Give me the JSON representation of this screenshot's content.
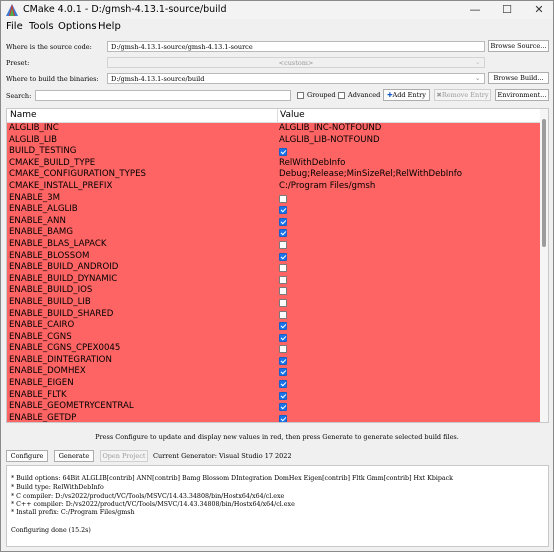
{
  "window": {
    "title": "CMake 4.0.1 - D:/gmsh-4.13.1-source/build",
    "controls": [
      "—",
      "☐",
      "✕"
    ]
  },
  "menu": [
    "File",
    "Tools",
    "Options",
    "Help"
  ],
  "source": {
    "label": "Where is the source code:",
    "value": "D:/gmsh-4.13.1-source/gmsh-4.13.1-source",
    "browse": "Browse Source..."
  },
  "preset": {
    "label": "Preset:",
    "value": "<custom>"
  },
  "build": {
    "label": "Where to build the binaries:",
    "value": "D:/gmsh-4.13.1-source/build",
    "browse": "Browse Build..."
  },
  "search": {
    "label": "Search:",
    "value": "",
    "grouped": "Grouped",
    "advanced": "Advanced",
    "add_entry": "Add Entry",
    "remove_entry": "Remove Entry",
    "environment": "Environment..."
  },
  "table": {
    "headers": [
      "Name",
      "Value"
    ],
    "rows": [
      {
        "name": "ALGLIB_INC",
        "value": "ALGLIB_INC-NOTFOUND"
      },
      {
        "name": "ALGLIB_LIB",
        "value": "ALGLIB_LIB-NOTFOUND"
      },
      {
        "name": "BUILD_TESTING",
        "check": true
      },
      {
        "name": "CMAKE_BUILD_TYPE",
        "value": "RelWithDebInfo"
      },
      {
        "name": "CMAKE_CONFIGURATION_TYPES",
        "value": "Debug;Release;MinSizeRel;RelWithDebInfo"
      },
      {
        "name": "CMAKE_INSTALL_PREFIX",
        "value": "C:/Program Files/gmsh"
      },
      {
        "name": "ENABLE_3M",
        "check": false
      },
      {
        "name": "ENABLE_ALGLIB",
        "check": true
      },
      {
        "name": "ENABLE_ANN",
        "check": true
      },
      {
        "name": "ENABLE_BAMG",
        "check": true
      },
      {
        "name": "ENABLE_BLAS_LAPACK",
        "check": false
      },
      {
        "name": "ENABLE_BLOSSOM",
        "check": true
      },
      {
        "name": "ENABLE_BUILD_ANDROID",
        "check": false
      },
      {
        "name": "ENABLE_BUILD_DYNAMIC",
        "check": false
      },
      {
        "name": "ENABLE_BUILD_IOS",
        "check": false
      },
      {
        "name": "ENABLE_BUILD_LIB",
        "check": false
      },
      {
        "name": "ENABLE_BUILD_SHARED",
        "check": false
      },
      {
        "name": "ENABLE_CAIRO",
        "check": true
      },
      {
        "name": "ENABLE_CGNS",
        "check": true
      },
      {
        "name": "ENABLE_CGNS_CPEX0045",
        "check": false
      },
      {
        "name": "ENABLE_DINTEGRATION",
        "check": true
      },
      {
        "name": "ENABLE_DOMHEX",
        "check": true
      },
      {
        "name": "ENABLE_EIGEN",
        "check": true
      },
      {
        "name": "ENABLE_FLTK",
        "check": true
      },
      {
        "name": "ENABLE_GEOMETRYCENTRAL",
        "check": true
      },
      {
        "name": "ENABLE_GETDP",
        "check": true
      }
    ]
  },
  "hint": "Press Configure to update and display new values in red, then press Generate to generate selected build files.",
  "bottom": {
    "configure": "Configure",
    "generate": "Generate",
    "open_project": "Open Project",
    "generator": "Current Generator: Visual Studio 17 2022"
  },
  "output": [
    " * Build options: 64Bit ALGLIB[contrib] ANN[contrib] Bamg Blossom DIntegration DomHex Eigen[contrib] Fltk Gmm[contrib] Hxt Kbipack",
    " * Build type: RelWithDebInfo",
    " * C compiler: D:/vs2022/product/VC/Tools/MSVC/14.43.34808/bin/Hostx64/x64/cl.exe",
    " * C++ compiler: D:/vs2022/product/VC/Tools/MSVC/14.43.34808/bin/Hostx64/x64/cl.exe",
    " * Install prefix: C:/Program Files/gmsh",
    "",
    "Configuring done (15.2s)"
  ],
  "colors": {
    "changed_row": "#ff6464",
    "checkbox_on": "#1a73e8"
  }
}
